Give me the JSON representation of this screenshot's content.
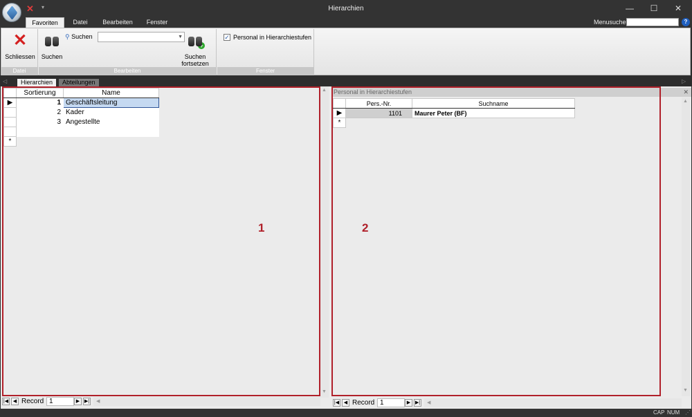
{
  "window": {
    "title": "Hierarchien",
    "minimize": "—",
    "maximize": "☐",
    "close": "✕"
  },
  "quick_access": {
    "close_glyph": "✕",
    "dropdown": "▾"
  },
  "ribbon_tabs": [
    "Favoriten",
    "Datei",
    "Bearbeiten",
    "Fenster"
  ],
  "menusuche": {
    "label": "Menusuche",
    "value": "",
    "help": "?"
  },
  "ribbon": {
    "groups": [
      {
        "label": "Datei"
      },
      {
        "label": "Bearbeiten"
      },
      {
        "label": "Fenster"
      }
    ],
    "schliessen_label": "Schliessen",
    "suchen_label": "Suchen",
    "suchen_small_label": "Suchen",
    "suchen_combo_value": "",
    "suchen_fortsetzen_line1": "Suchen",
    "suchen_fortsetzen_line2": "fortsetzen",
    "personal_checkbox_label": "Personal in Hierarchiestufen",
    "personal_checked": true
  },
  "doc_tabs": [
    "Hierarchien",
    "Abteilungen"
  ],
  "left_grid": {
    "columns": [
      "Sortierung",
      "Name"
    ],
    "rows": [
      {
        "sort": "1",
        "name": "Geschäftsleitung",
        "current": true
      },
      {
        "sort": "2",
        "name": "Kader"
      },
      {
        "sort": "3",
        "name": "Angestellte"
      }
    ],
    "new_row_marker": "*",
    "current_marker": "▶"
  },
  "right_pane": {
    "header": "Personal in Hierarchiestufen",
    "columns": [
      "Pers.-Nr.",
      "Suchname"
    ],
    "rows": [
      {
        "nr": "1101",
        "name": "Maurer Peter (BF)"
      }
    ]
  },
  "navigation": {
    "record_label": "Record",
    "left_value": "1",
    "right_value": "1"
  },
  "annotations": {
    "left": "1",
    "right": "2",
    "color": "#b0202a"
  },
  "status": {
    "cap": "CAP",
    "num": "NUM"
  }
}
